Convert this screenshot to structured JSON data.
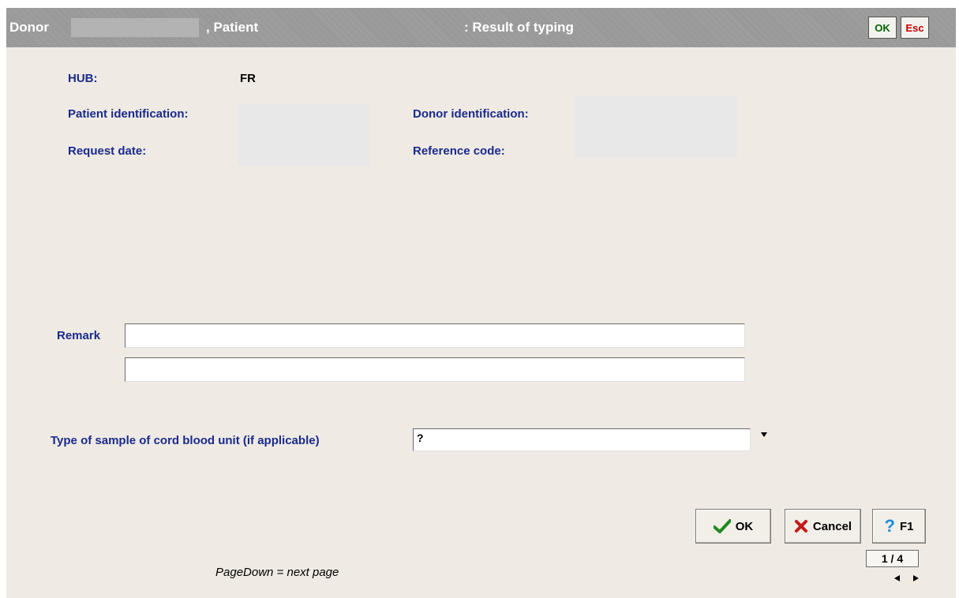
{
  "titlebar": {
    "donor_label": "Donor",
    "patient_label": ", Patient",
    "result_label": ": Result of typing",
    "ok_label": "OK",
    "esc_label": "Esc"
  },
  "form": {
    "hub_label": "HUB:",
    "hub_value": "FR",
    "patient_id_label": "Patient identification:",
    "donor_id_label": "Donor identification:",
    "request_date_label": "Request date:",
    "reference_code_label": "Reference code:",
    "remark_label": "Remark",
    "remark_line1": "",
    "remark_line2": "",
    "sample_type_label": "Type of sample of cord blood unit (if applicable)",
    "sample_type_value": "?"
  },
  "buttons": {
    "ok": "OK",
    "cancel": "Cancel",
    "help": "F1"
  },
  "footer": {
    "hint": "PageDown = next page",
    "page_indicator": "1 / 4"
  }
}
